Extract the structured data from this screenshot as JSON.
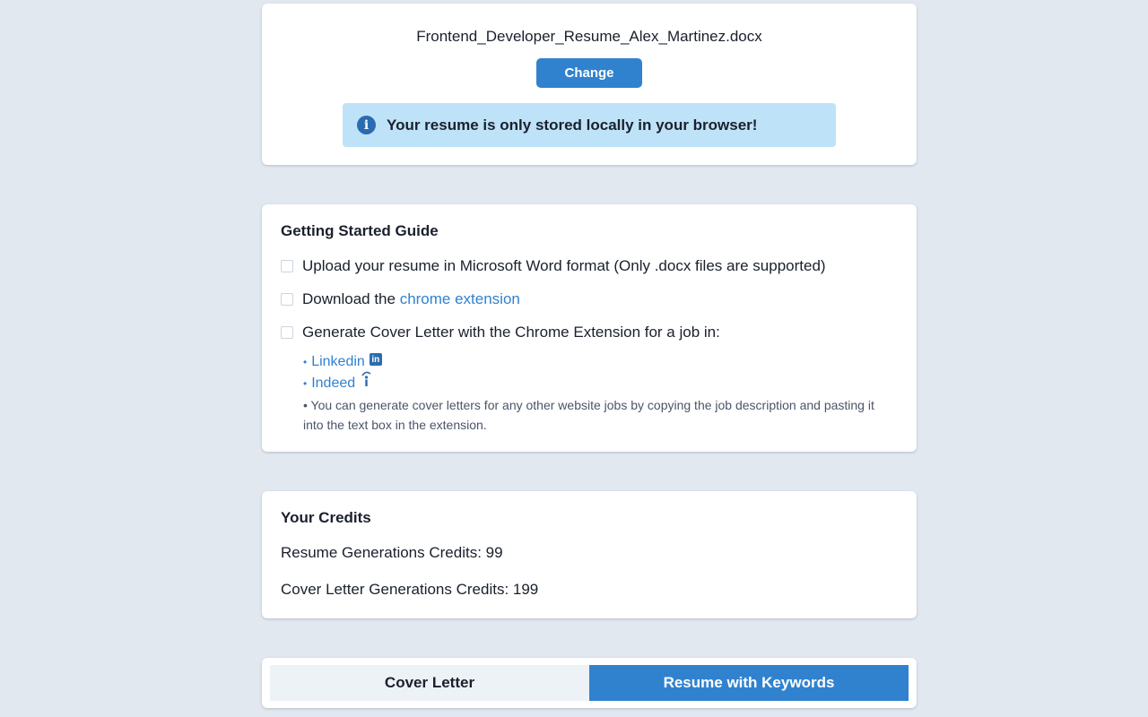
{
  "upload": {
    "filename": "Frontend_Developer_Resume_Alex_Martinez.docx",
    "change_label": "Change",
    "info_message": "Your resume is only stored locally in your browser!"
  },
  "guide": {
    "title": "Getting Started Guide",
    "step1": "Upload your resume in Microsoft Word format (Only .docx files are supported)",
    "step2_prefix": "Download the ",
    "step2_link": "chrome extension",
    "step3": "Generate Cover Letter with the Chrome Extension for a job in:",
    "bullet": "•",
    "linkedin_label": "Linkedin",
    "linkedin_icon_text": "in",
    "indeed_label": "Indeed",
    "note": "• You can generate cover letters for any other website jobs by copying the job description and pasting it into the text box in the extension."
  },
  "credits": {
    "title": "Your Credits",
    "resume_credits": "Resume Generations Credits: 99",
    "cover_letter_credits": "Cover Letter Generations Credits: 199"
  },
  "tabs": {
    "cover_letter": "Cover Letter",
    "resume_keywords": "Resume with Keywords",
    "active": "resume_keywords"
  },
  "colors": {
    "accent": "#3182ce",
    "info_bg": "#bee3f8",
    "page_bg": "#e2e8f0"
  }
}
